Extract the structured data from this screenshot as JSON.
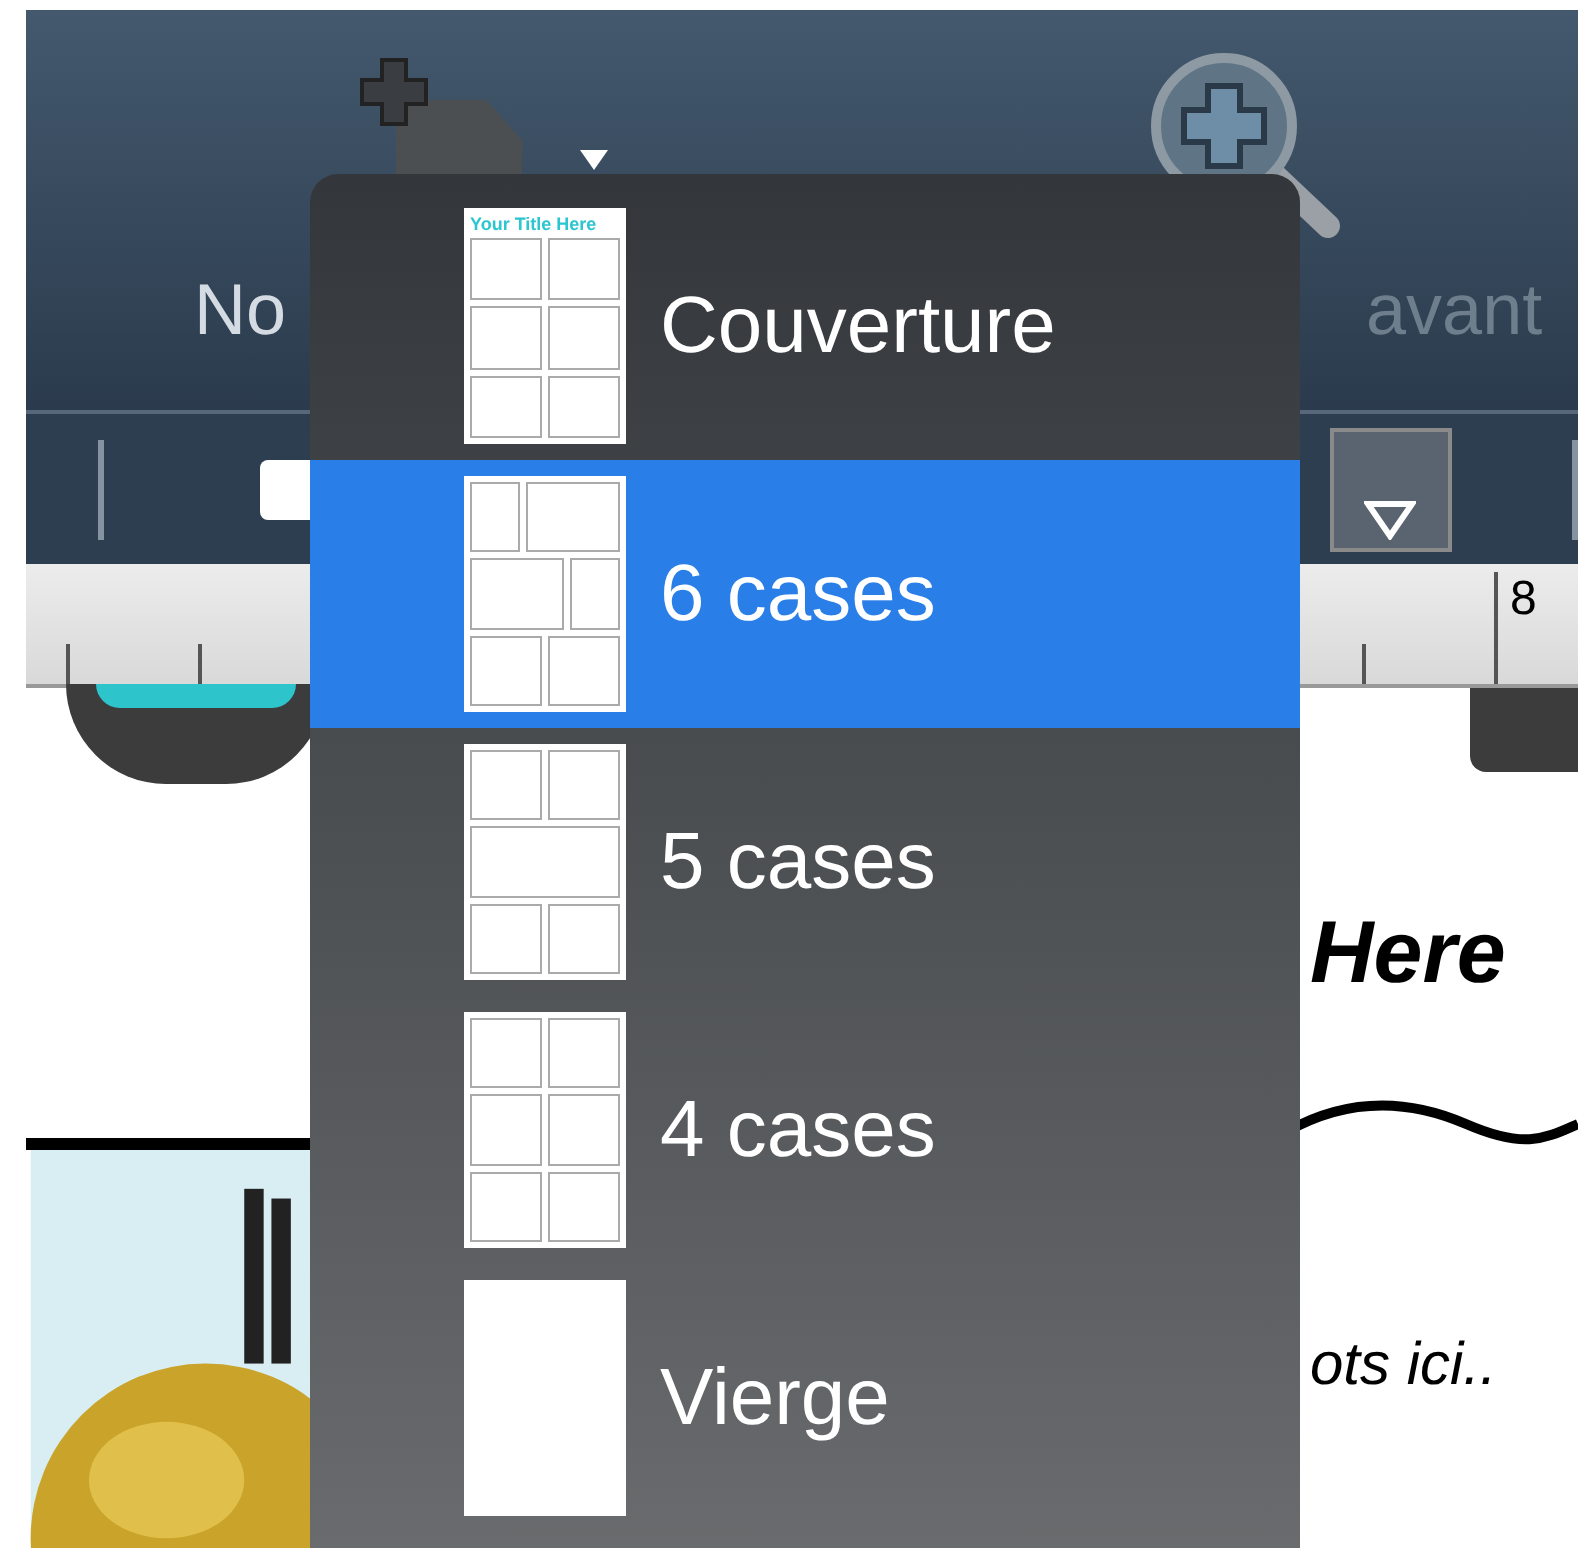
{
  "toolbar": {
    "buttons": [
      {
        "label": "No"
      },
      {
        "label": "avant"
      }
    ]
  },
  "ruler": {
    "number": "8"
  },
  "comic_page": {
    "heading": "Here",
    "caption": "ots ici.."
  },
  "menu": {
    "items": [
      {
        "label": "Couverture",
        "selected": false,
        "thumbnail": {
          "kind": "cover",
          "title": "Your Title Here"
        }
      },
      {
        "label": "6 cases",
        "selected": true,
        "thumbnail": {
          "kind": "six"
        }
      },
      {
        "label": "5 cases",
        "selected": false,
        "thumbnail": {
          "kind": "five"
        }
      },
      {
        "label": "4 cases",
        "selected": false,
        "thumbnail": {
          "kind": "four"
        }
      },
      {
        "label": "Vierge",
        "selected": false,
        "thumbnail": {
          "kind": "blank"
        }
      }
    ]
  }
}
